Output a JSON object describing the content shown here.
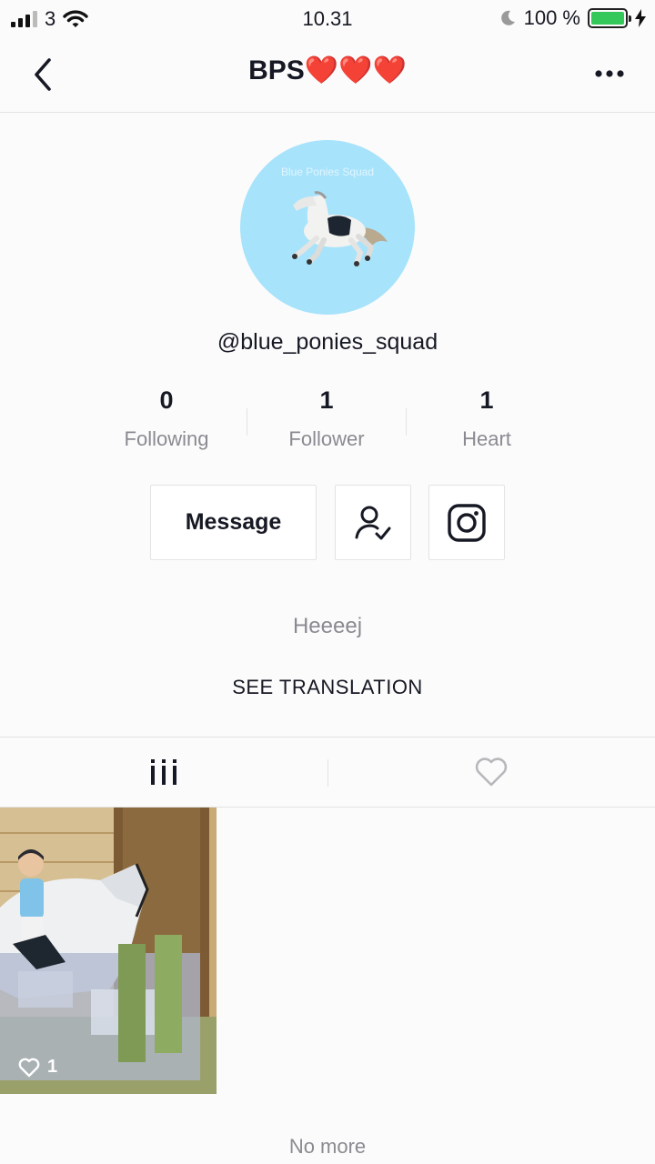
{
  "status_bar": {
    "carrier": "3",
    "time": "10.31",
    "battery": "100 %",
    "battery_level": 1.0
  },
  "nav": {
    "title": "BPS❤️❤️❤️",
    "back_icon": "chevron-left-icon",
    "more_icon": "more-icon"
  },
  "profile": {
    "avatar_text": "Blue Ponies Squad",
    "username": "@blue_ponies_squad",
    "stats": [
      {
        "value": "0",
        "label": "Following"
      },
      {
        "value": "1",
        "label": "Follower"
      },
      {
        "value": "1",
        "label": "Heart"
      }
    ],
    "message_label": "Message",
    "bio": "Heeeej",
    "see_translation": "SEE TRANSLATION"
  },
  "tabs": [
    {
      "icon": "grid-icon",
      "active": true
    },
    {
      "icon": "heart-outline-icon",
      "active": false
    }
  ],
  "videos": [
    {
      "likes": "1"
    }
  ],
  "footer": {
    "no_more": "No more"
  },
  "colors": {
    "battery_green": "#34c759",
    "avatar_bg": "#a7e3fb",
    "secondary_text": "#8a8b91"
  }
}
